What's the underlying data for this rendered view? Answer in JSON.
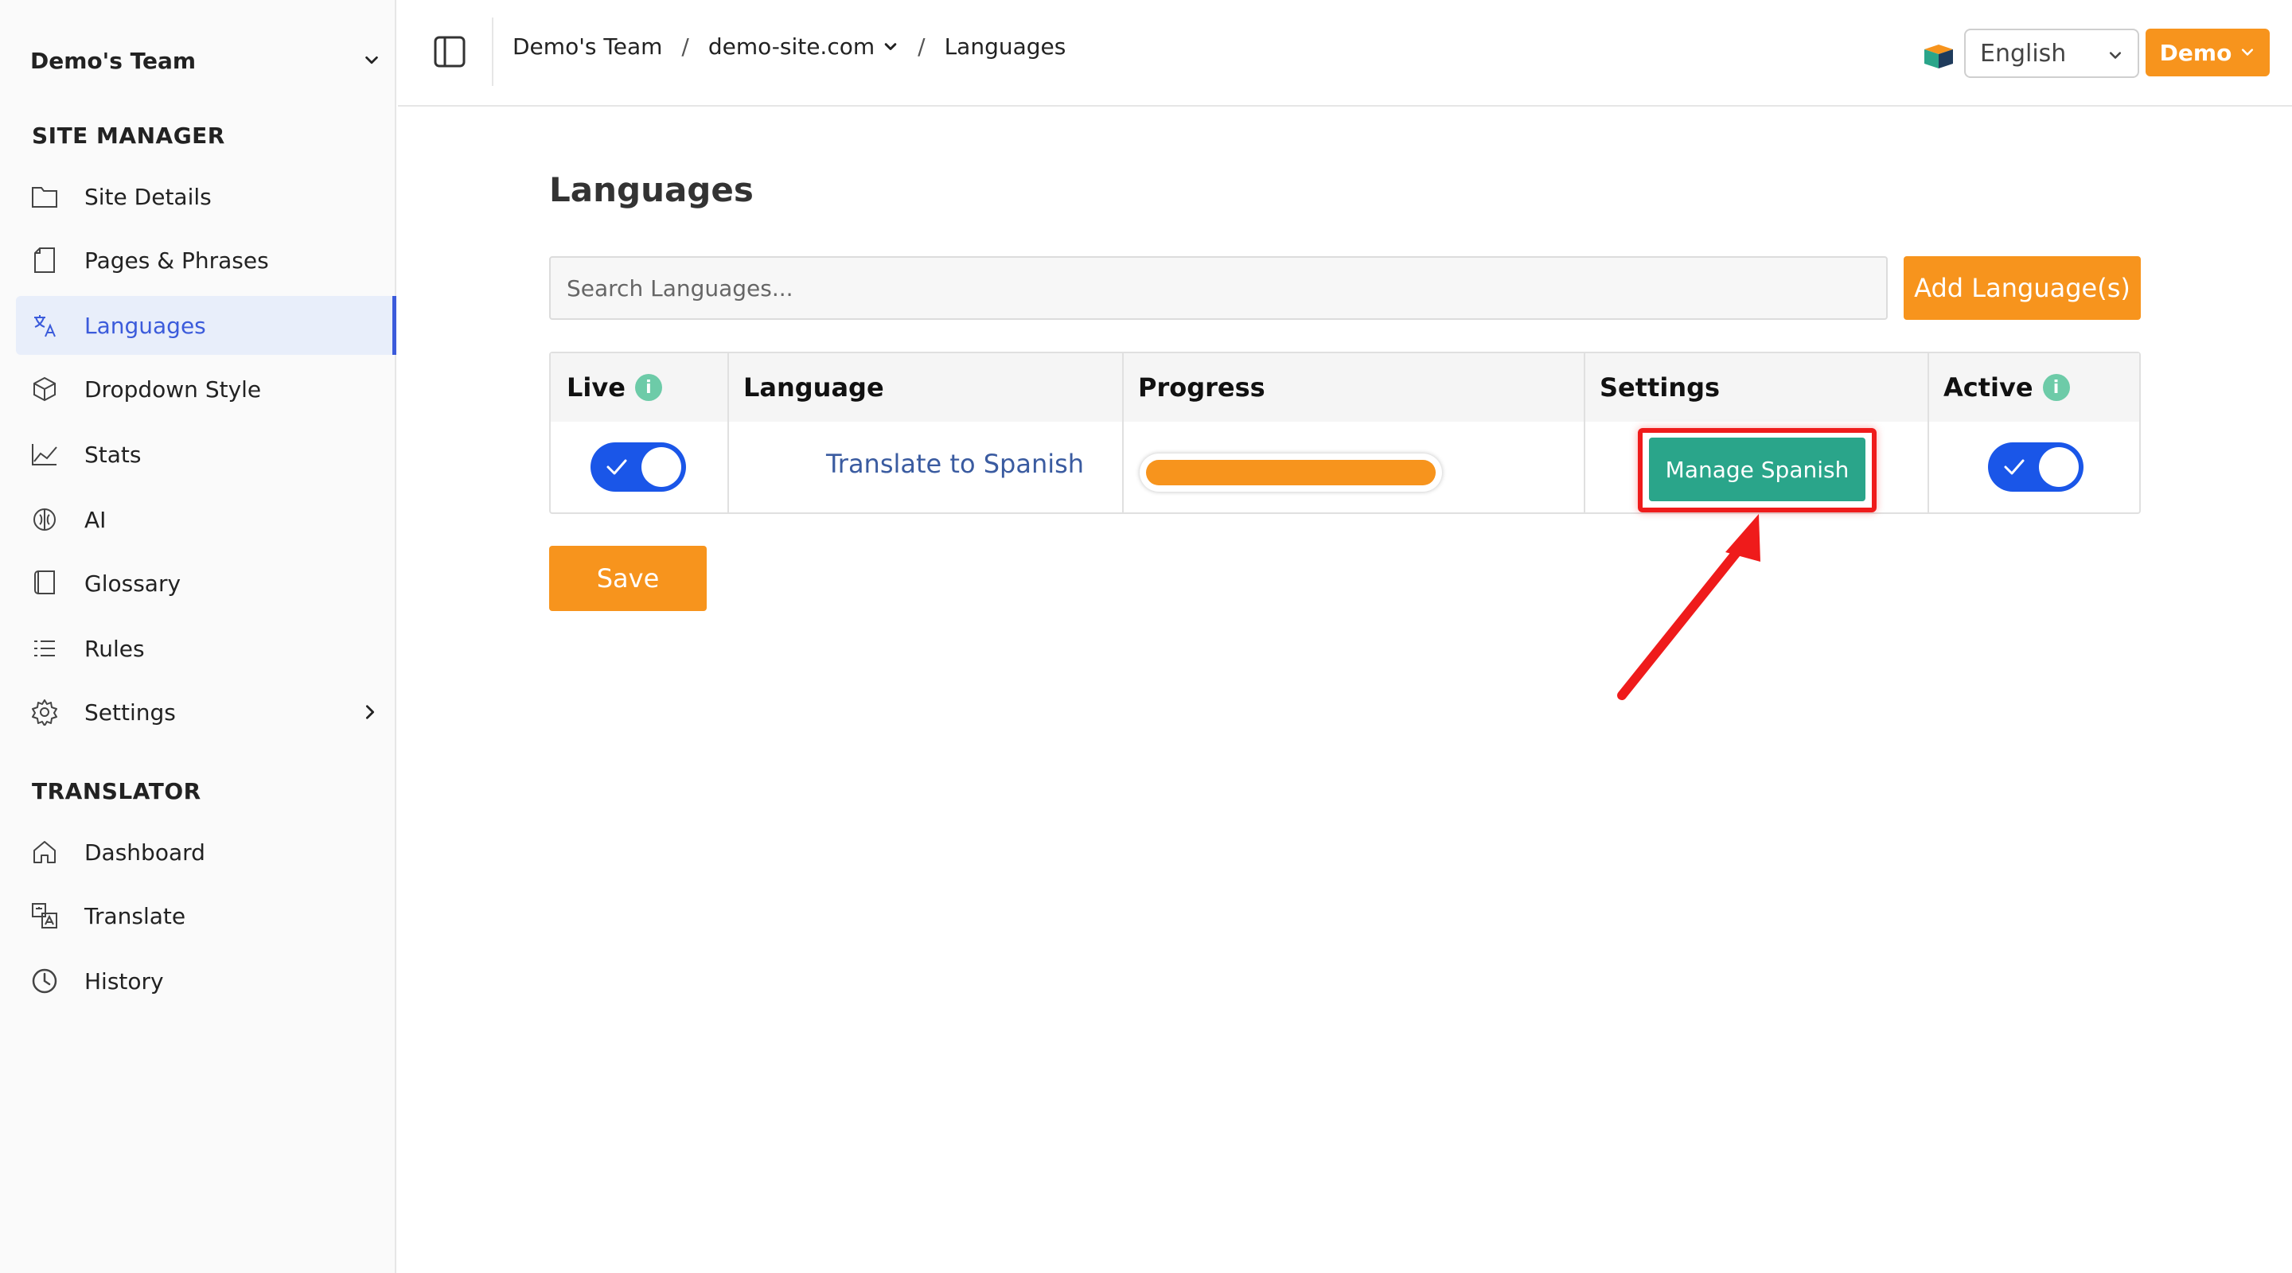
{
  "sidebar": {
    "team_name": "Demo's Team",
    "sections": [
      {
        "title": "SITE MANAGER",
        "items": [
          {
            "label": "Site Details",
            "icon": "folder-icon"
          },
          {
            "label": "Pages & Phrases",
            "icon": "page-icon"
          },
          {
            "label": "Languages",
            "icon": "translate-icon",
            "active": true
          },
          {
            "label": "Dropdown Style",
            "icon": "cube-icon"
          },
          {
            "label": "Stats",
            "icon": "chart-icon"
          },
          {
            "label": "AI",
            "icon": "ai-icon"
          },
          {
            "label": "Glossary",
            "icon": "book-icon"
          },
          {
            "label": "Rules",
            "icon": "list-icon"
          },
          {
            "label": "Settings",
            "icon": "gear-icon"
          }
        ]
      },
      {
        "title": "TRANSLATOR",
        "items": [
          {
            "label": "Dashboard",
            "icon": "home-icon"
          },
          {
            "label": "Translate",
            "icon": "translate-box-icon"
          },
          {
            "label": "History",
            "icon": "clock-icon"
          }
        ]
      }
    ]
  },
  "header": {
    "breadcrumb": [
      "Demo's Team",
      "demo-site.com",
      "Languages"
    ],
    "language_select": "English",
    "account_button": "Demo"
  },
  "main": {
    "title": "Languages",
    "search_placeholder": "Search Languages...",
    "add_button": "Add Language(s)",
    "table": {
      "headers": [
        "Live",
        "Language",
        "Progress",
        "Settings",
        "Active"
      ],
      "rows": [
        {
          "live": true,
          "language_link": "Translate to Spanish",
          "progress": 1.0,
          "settings_button": "Manage Spanish",
          "active": true
        }
      ]
    },
    "save_button": "Save"
  },
  "colors": {
    "accent_orange": "#f7941d",
    "toggle_blue": "#1a56e8",
    "manage_green": "#2aa58a",
    "active_nav": "#3b5bdb",
    "highlight_red": "#ef1b1b",
    "info_teal": "#6dcba8"
  }
}
